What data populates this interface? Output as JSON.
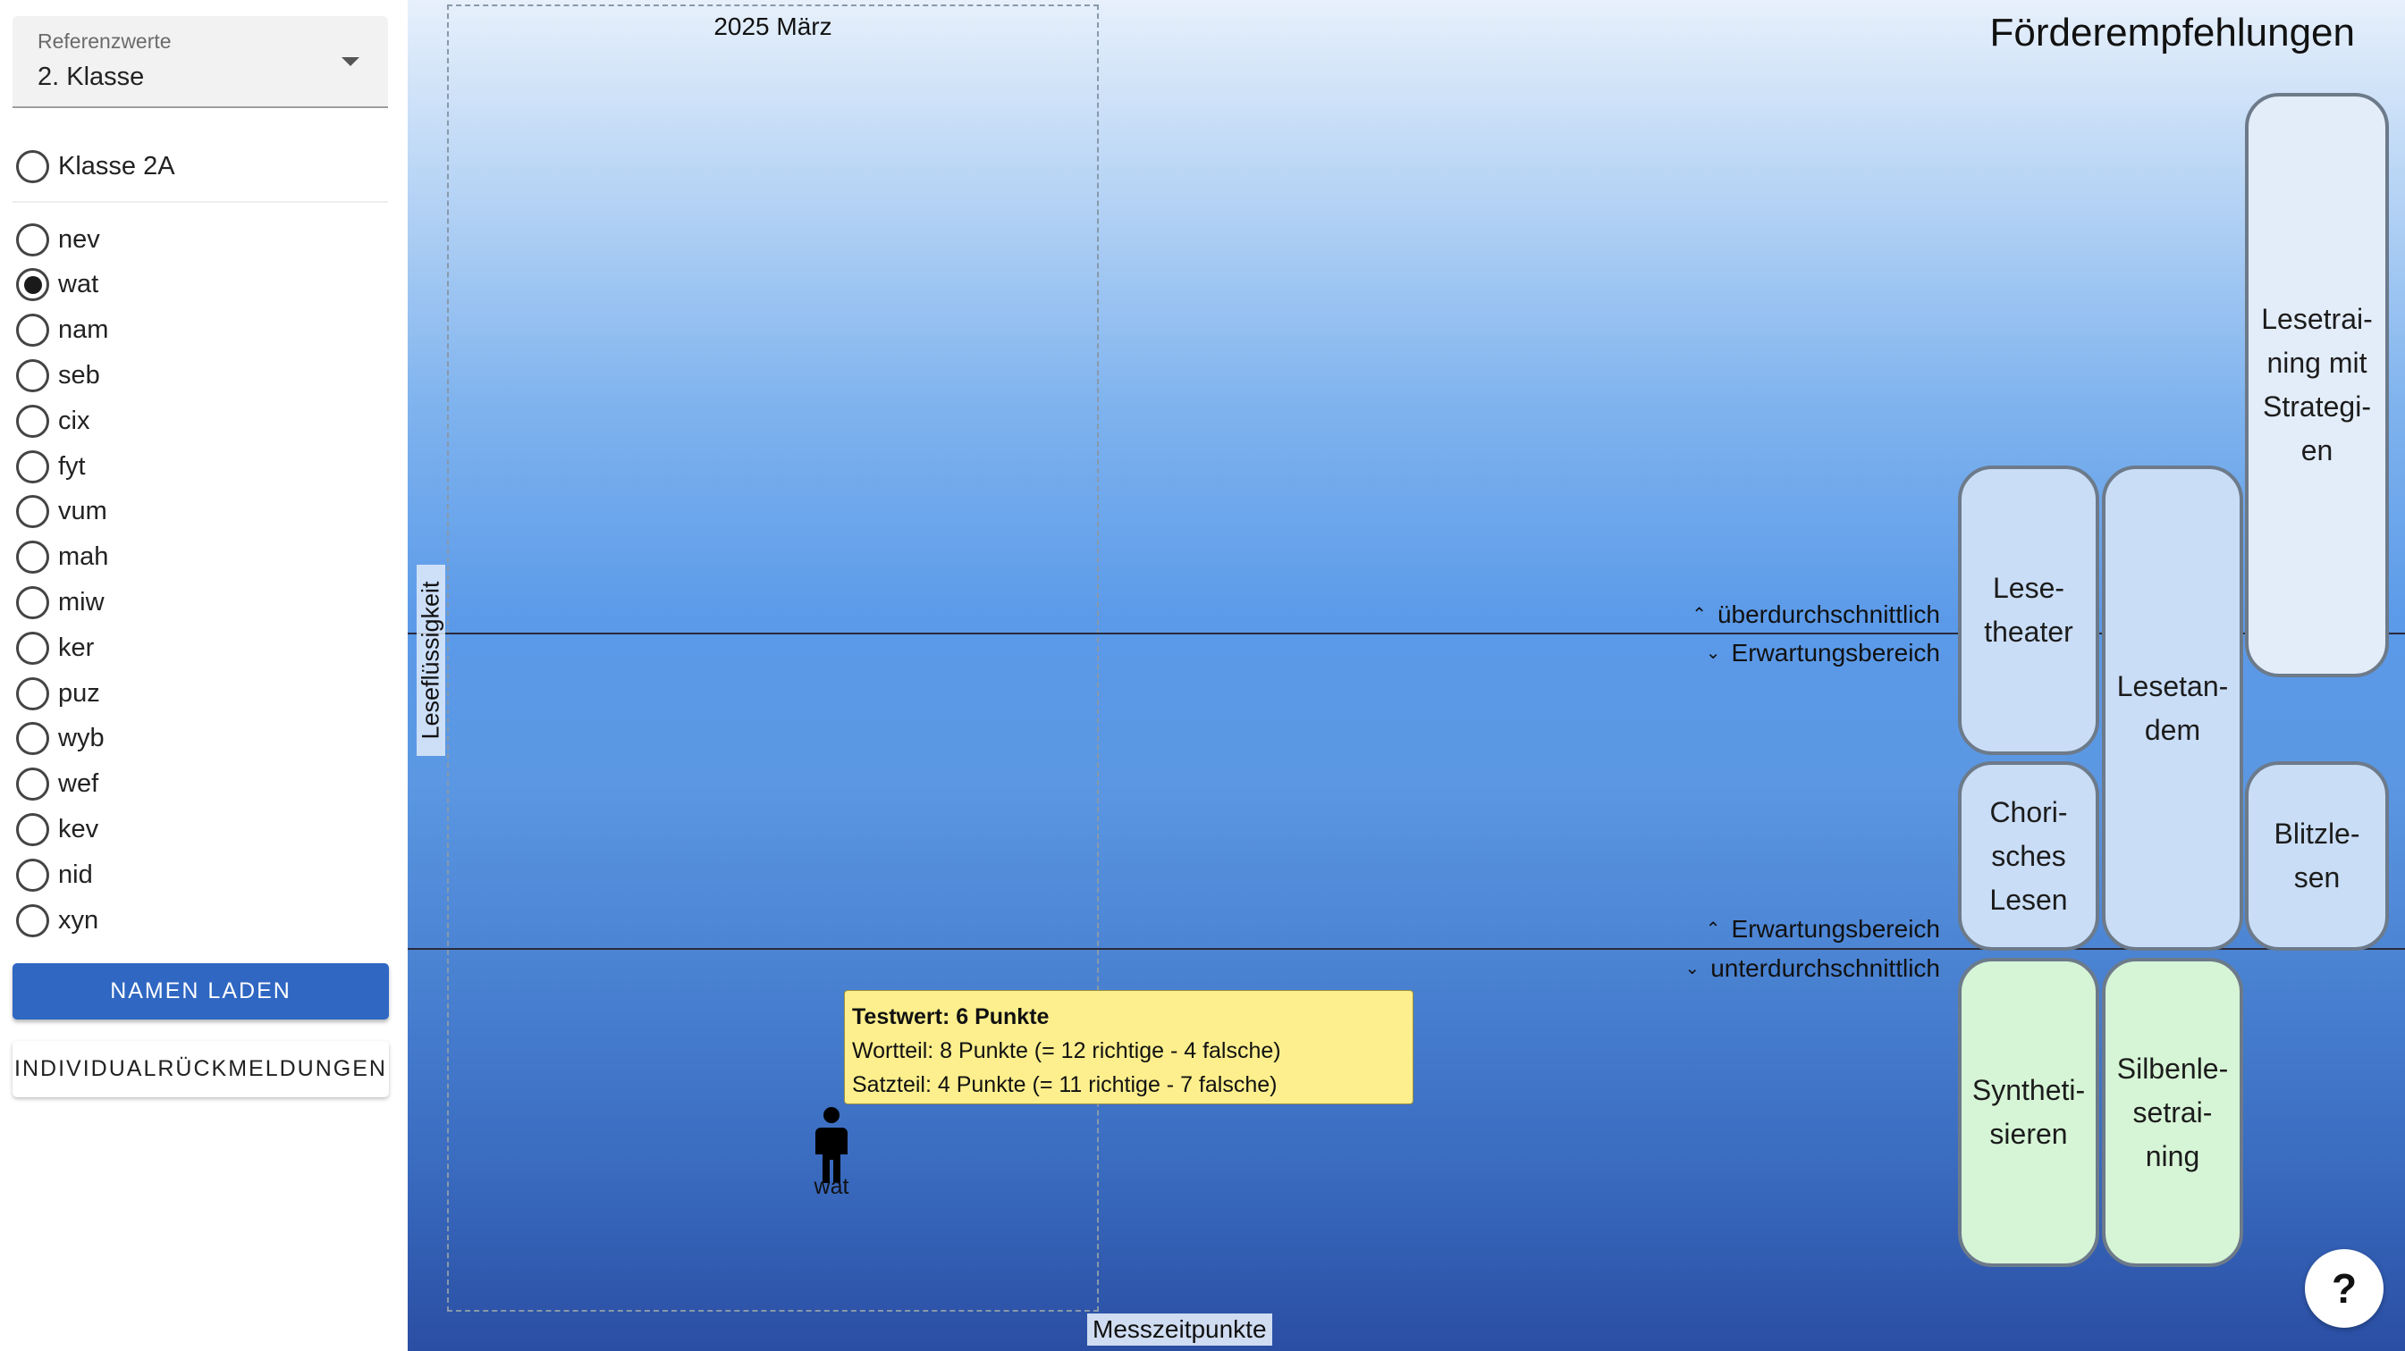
{
  "sidebar": {
    "select": {
      "label": "Referenzwerte",
      "value": "2. Klasse"
    },
    "class_option": {
      "label": "Klasse 2A"
    },
    "students": [
      {
        "label": "nev",
        "checked": false
      },
      {
        "label": "wat",
        "checked": true
      },
      {
        "label": "nam",
        "checked": false
      },
      {
        "label": "seb",
        "checked": false
      },
      {
        "label": "cix",
        "checked": false
      },
      {
        "label": "fyt",
        "checked": false
      },
      {
        "label": "vum",
        "checked": false
      },
      {
        "label": "mah",
        "checked": false
      },
      {
        "label": "miw",
        "checked": false
      },
      {
        "label": "ker",
        "checked": false
      },
      {
        "label": "puz",
        "checked": false
      },
      {
        "label": "wyb",
        "checked": false
      },
      {
        "label": "wef",
        "checked": false
      },
      {
        "label": "kev",
        "checked": false
      },
      {
        "label": "nid",
        "checked": false
      },
      {
        "label": "xyn",
        "checked": false
      }
    ],
    "load_names_button": "NAMEN LADEN",
    "feedback_button": "INDIVIDUALRÜCKMELDUNGEN"
  },
  "chart": {
    "time_window_label": "2025 März",
    "y_axis_label": "Leseflüssigkeit",
    "x_axis_label": "Messzeitpunkte",
    "upper_line": {
      "above": "überdurchschnittlich",
      "below": "Erwartungsbereich"
    },
    "lower_line": {
      "above": "Erwartungsbereich",
      "below": "unterdurchschnittlich"
    },
    "tooltip": {
      "title": "Testwert: 6 Punkte",
      "line1": "Wortteil: 8 Punkte (= 12 richtige - 4 falsche)",
      "line2": "Satzteil: 4 Punkte (= 11 richtige - 7 falsche)"
    },
    "student_marker": {
      "label": "wat",
      "icon": "person-icon"
    }
  },
  "recommendations": {
    "title": "Förderempfehlungen",
    "cards": {
      "lesetheater": "Lese-\ntheater",
      "chorisches": "Chori-\nsches\nLesen",
      "synthetisieren": "Syntheti-\nsieren",
      "lesetandem": "Lesetan-\ndem",
      "silbenlese": "Silbenle-\nsetrai-\nning",
      "lesetraining": "Lesetrai-\nning mit\nStrategi-\nen",
      "blitzlesen": "Blitzle-\nsen"
    }
  },
  "help_button": "?",
  "colors": {
    "primary": "#2f67c2",
    "tooltip_bg": "#fdef8d",
    "card_blue": "#c9ddf6",
    "card_green": "#d6f5d6"
  }
}
